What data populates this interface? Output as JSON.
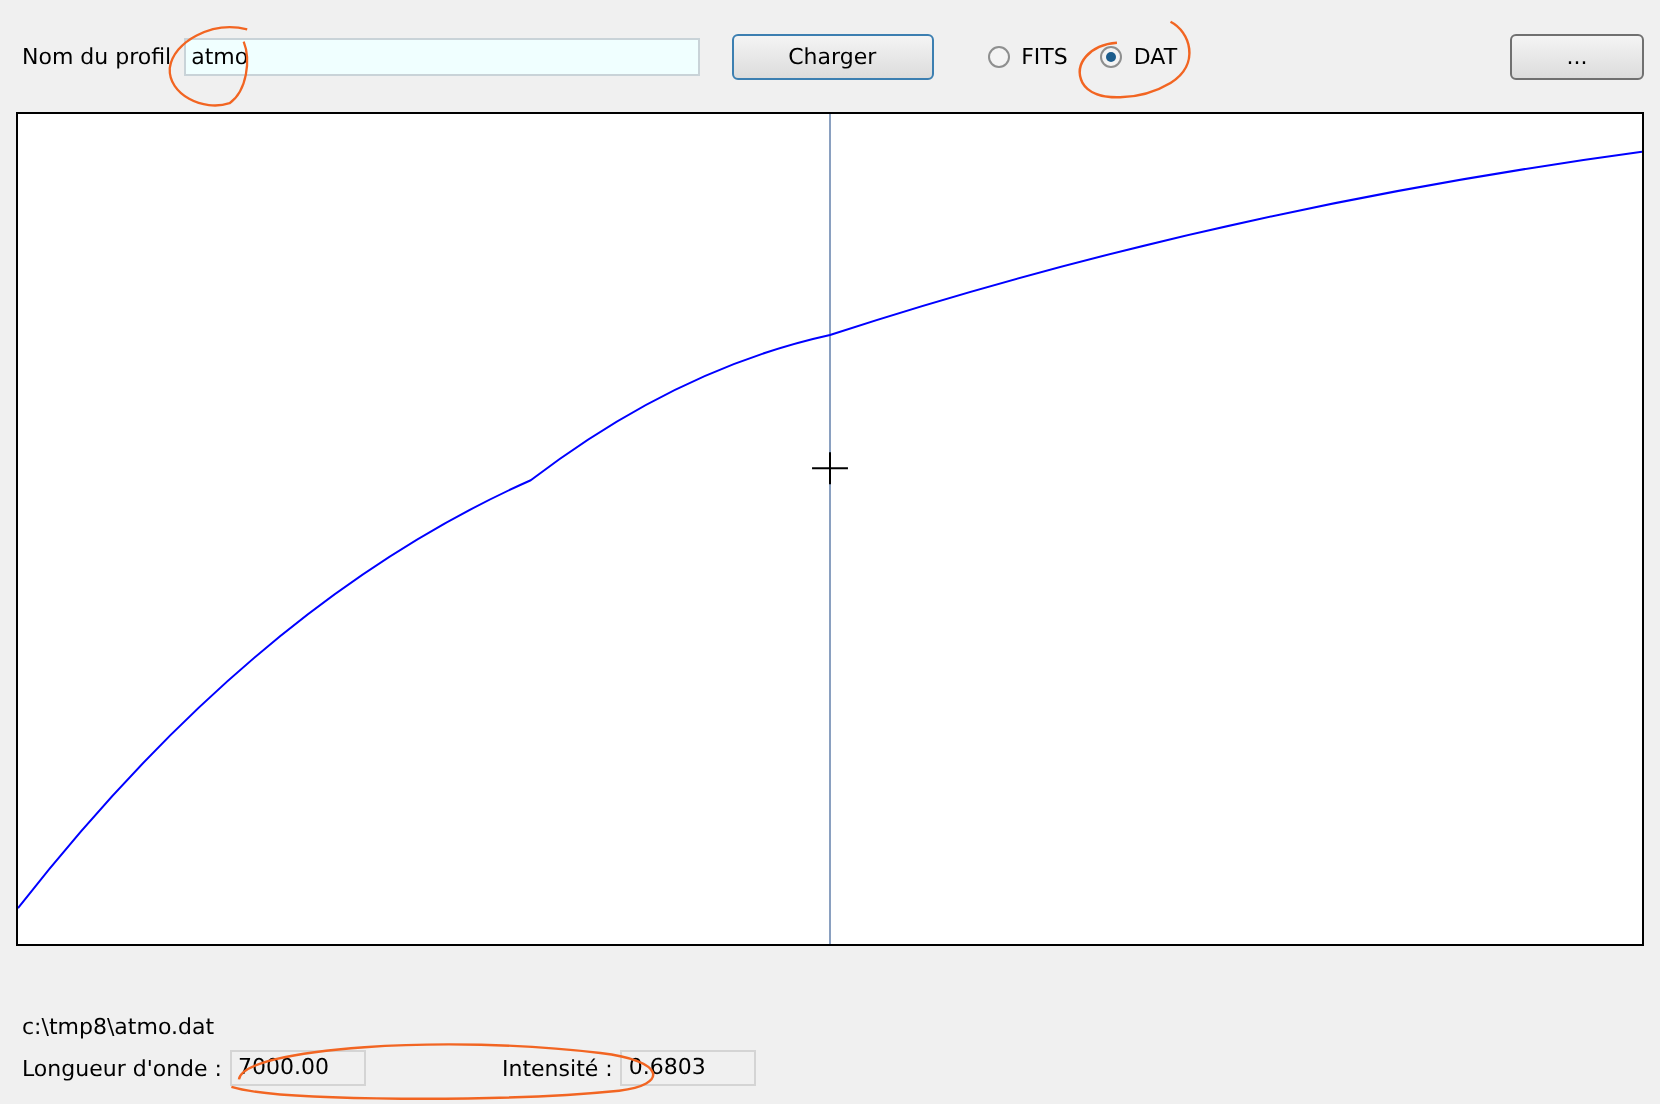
{
  "profile": {
    "label": "Nom du profil",
    "value": "atmo"
  },
  "load_button": "Charger",
  "formats": [
    {
      "label": "FITS",
      "selected": false
    },
    {
      "label": "DAT",
      "selected": true
    }
  ],
  "browse_button": "...",
  "file_path": "c:\\tmp8\\atmo.dat",
  "readouts": [
    {
      "label": "Longueur d'onde :",
      "value": "7000.00"
    },
    {
      "label": "Intensité :",
      "value": "0.6803"
    }
  ]
}
